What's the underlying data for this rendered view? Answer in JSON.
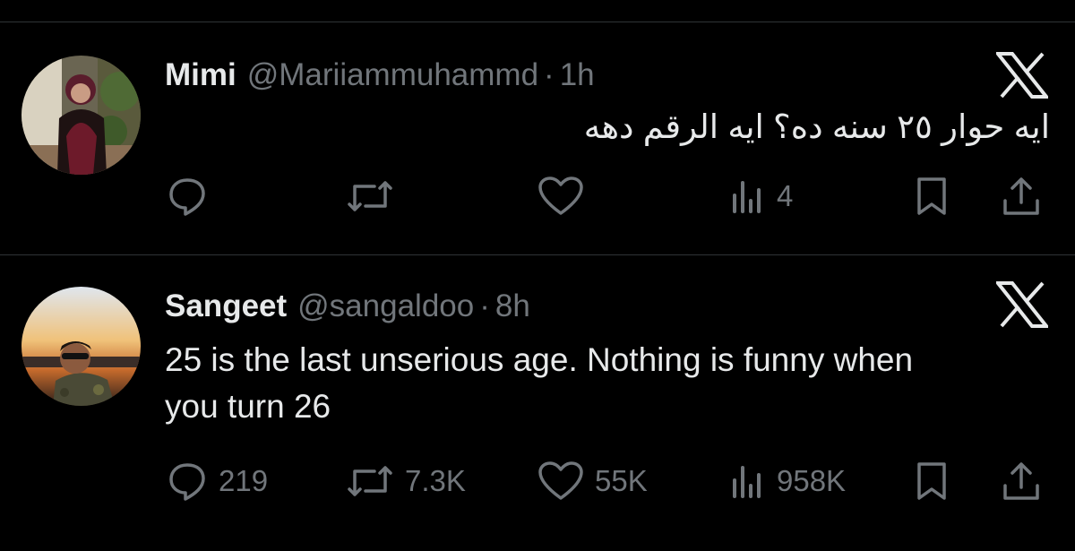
{
  "tweets": [
    {
      "display_name": "Mimi",
      "handle": "@Mariiammuhammd",
      "separator": "·",
      "time": "1h",
      "text": "ایه حوار ٢٥ سنه ده؟ ایه الرقم دهه",
      "replies": "",
      "retweets": "",
      "likes": "",
      "views": "4"
    },
    {
      "display_name": "Sangeet",
      "handle": "@sangaldoo",
      "separator": "·",
      "time": "8h",
      "text": "25 is the last unserious age. Nothing is funny when you turn 26",
      "replies": "219",
      "retweets": "7.3K",
      "likes": "55K",
      "views": "958K"
    }
  ],
  "icons": {
    "reply": "speech-bubble-icon",
    "retweet": "retweet-arrows-icon",
    "like": "heart-icon",
    "views": "bar-chart-icon",
    "bookmark": "bookmark-icon",
    "share": "share-upload-icon",
    "brand": "x-logo-icon"
  },
  "colors": {
    "background": "#000000",
    "primary_text": "#e7e9ea",
    "secondary_text": "#71767b",
    "divider": "#2f3336"
  }
}
